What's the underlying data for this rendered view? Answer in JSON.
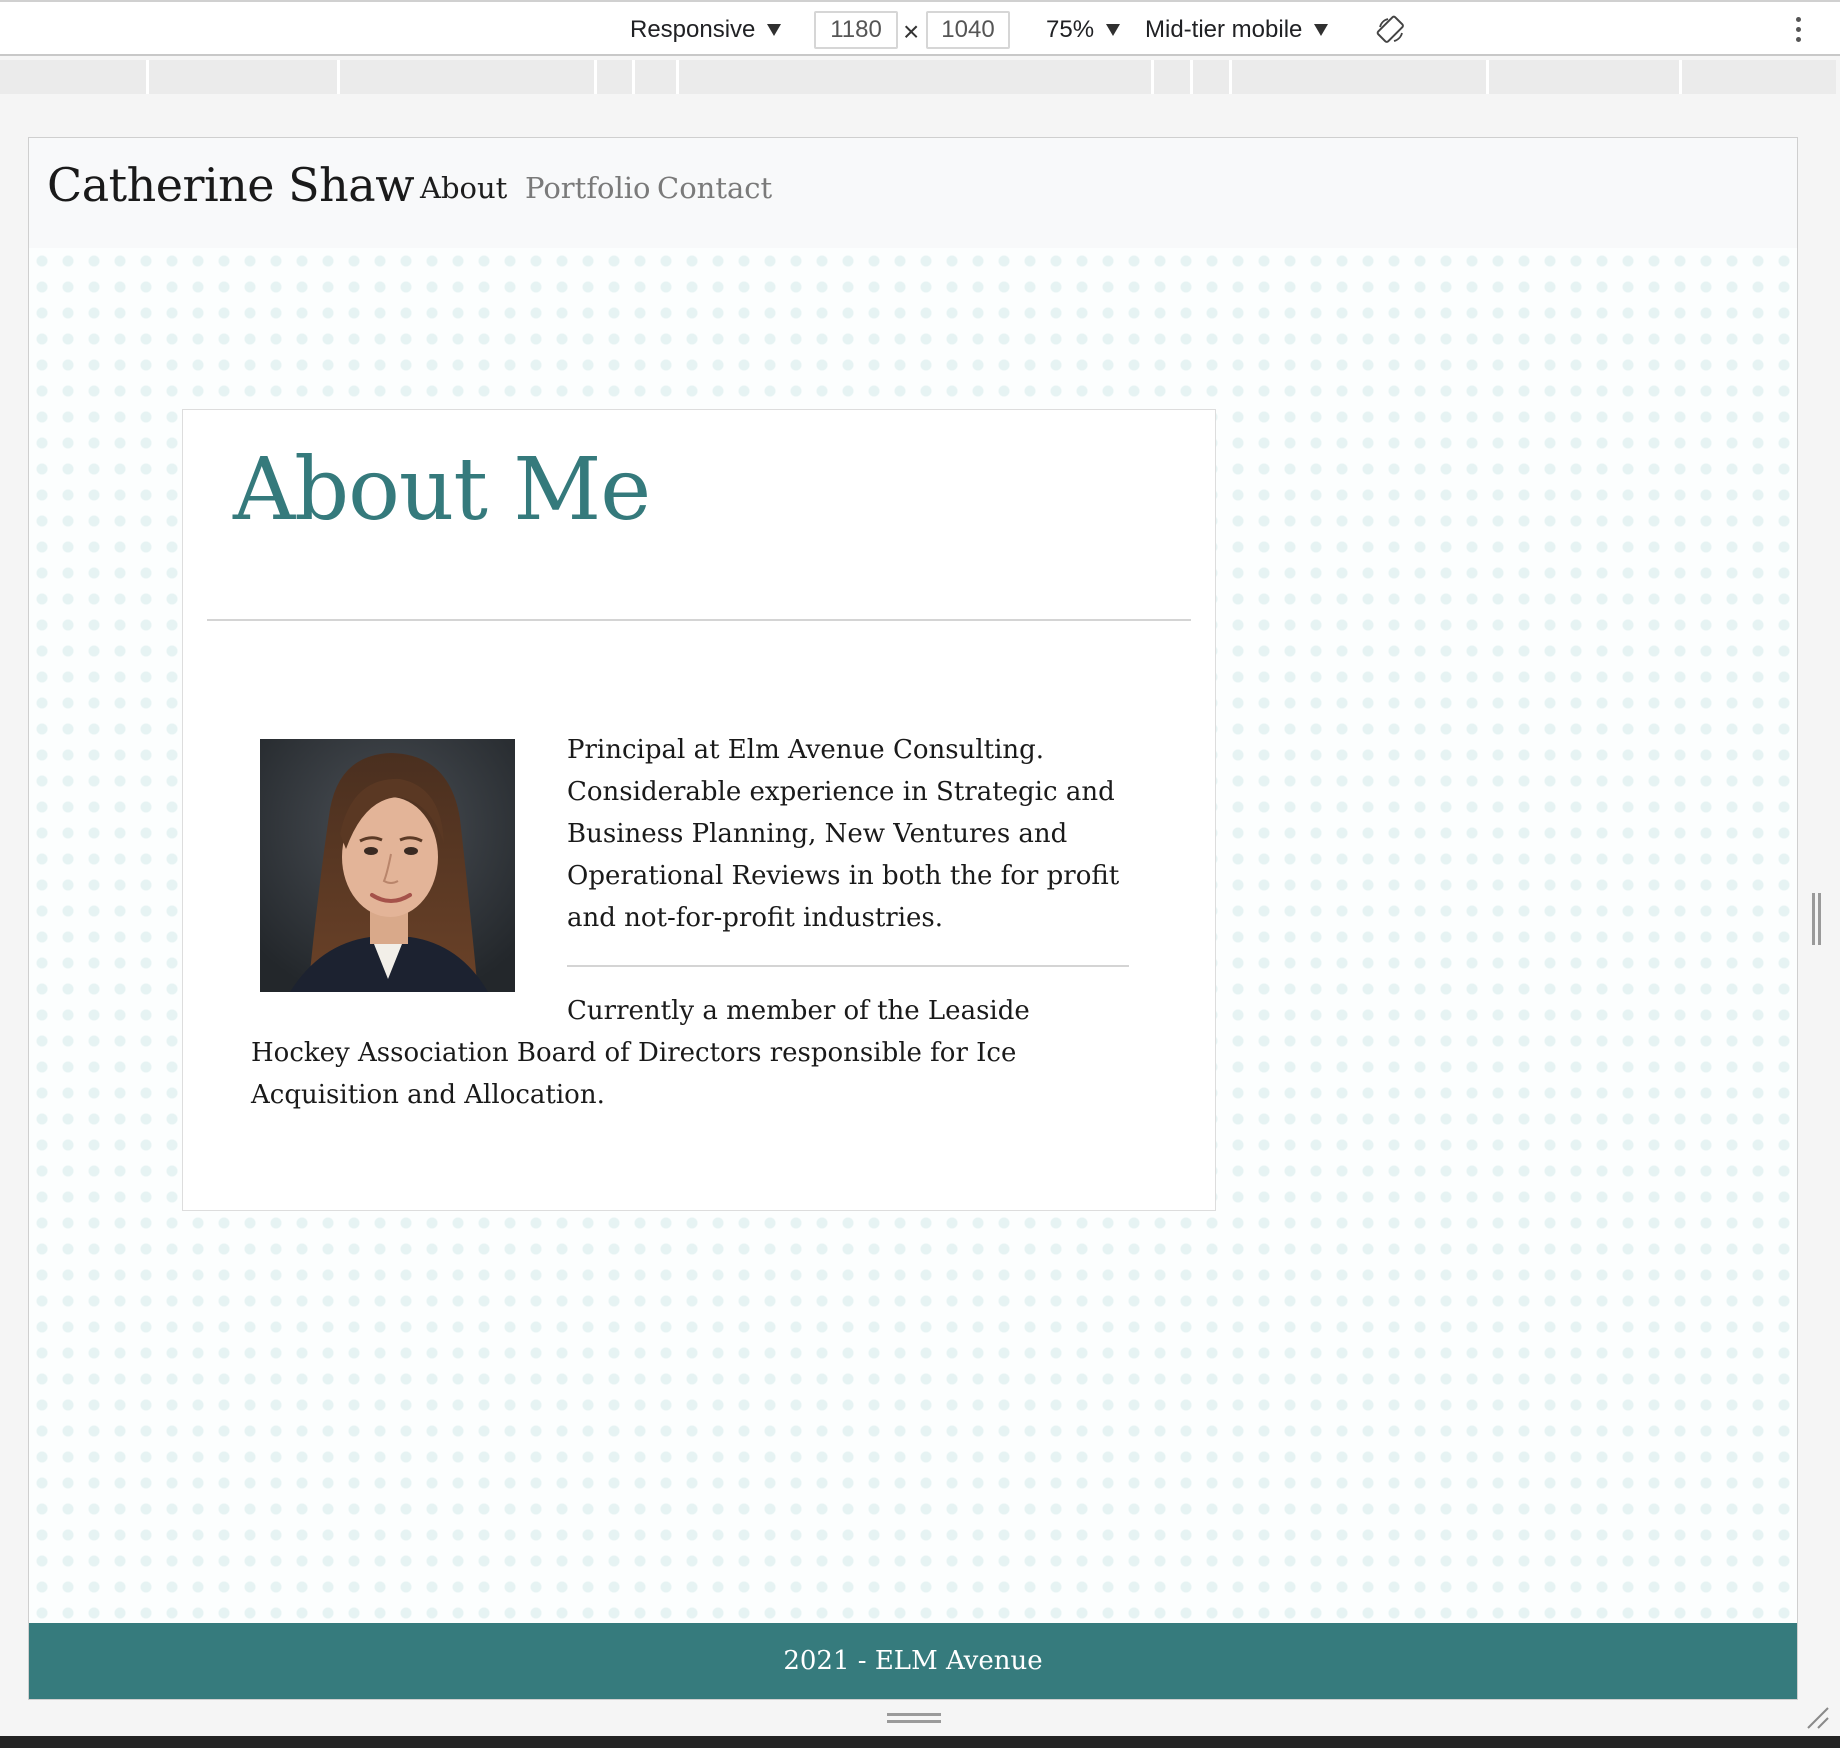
{
  "devtools": {
    "device_label": "Responsive",
    "width_value": "1180",
    "height_value": "1040",
    "times_symbol": "×",
    "zoom_label": "75%",
    "throttle_label": "Mid-tier mobile"
  },
  "site": {
    "brand": "Catherine Shaw",
    "nav": {
      "about": "About",
      "portfolio": "Portfolio",
      "contact": "Contact"
    },
    "accent_color": "#367b7d",
    "about": {
      "title": "About Me",
      "paragraph1": "Principal at Elm Avenue Consulting. Considerable experience in Strategic and Business Planning, New Ventures and Operational Reviews in both the for profit and not-for-profit industries.",
      "paragraph2": "Currently a member of the Leaside Hockey Association Board of Directors responsible for Ice Acquisition and Allocation."
    },
    "footer": "2021 - ELM Avenue"
  },
  "icons": {
    "rotate": "rotate-icon",
    "more": "more-options-icon",
    "resize": "resize-handle-icon"
  }
}
